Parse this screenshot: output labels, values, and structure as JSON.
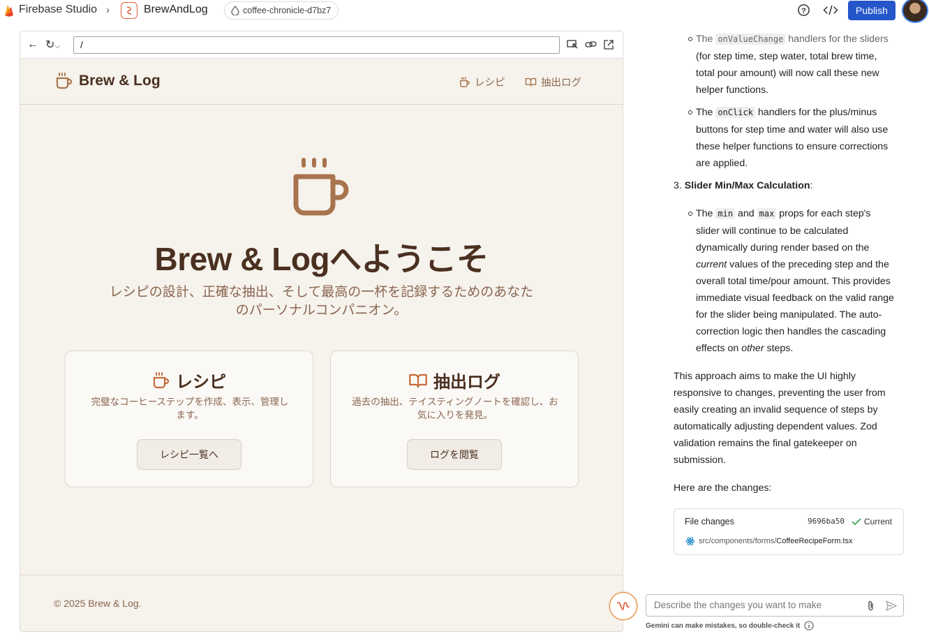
{
  "topbar": {
    "studio_name": "Firebase Studio",
    "app_name": "BrewAndLog",
    "workspace": "coffee-chronicle-d7bz7",
    "publish_label": "Publish"
  },
  "browser": {
    "url": "/"
  },
  "site": {
    "title": "Brew & Log",
    "nav": {
      "recipes": "レシピ",
      "logs": "抽出ログ"
    },
    "hero_title": "Brew & Logへようこそ",
    "hero_sub_line1": "レシピの設計、正確な抽出、そして最高の一杯を記録するためのあなた",
    "hero_sub_line2": "のパーソナルコンパニオン。",
    "cards": [
      {
        "title": "レシピ",
        "desc": "完璧なコーヒーステップを作成、表示、管理します。",
        "button": "レシピ一覧へ"
      },
      {
        "title": "抽出ログ",
        "desc": "過去の抽出、テイスティングノートを確認し、お気に入りを発見。",
        "button": "ログを閲覧"
      }
    ],
    "footer": "© 2025 Brew & Log."
  },
  "chat": {
    "b1_a": "The ",
    "b1_code": "onValueChange",
    "b1_b": " handlers for the sliders",
    "b1_l2": "(for step time, step water, total brew time,",
    "b1_l3": "total pour amount) will now call these new",
    "b1_l4": "helper functions.",
    "b2_a": "The ",
    "b2_code": "onClick",
    "b2_b": " handlers for the plus/minus",
    "b2_l2": "buttons for step time and water will also use",
    "b2_l3": "these helper functions to ensure corrections",
    "b2_l4": "are applied.",
    "item3_num": "3.",
    "item3_bold": "Slider Min/Max Calculation",
    "item3_colon": ":",
    "b3_a": "The ",
    "b3_code1": "min",
    "b3_and": " and ",
    "b3_code2": "max",
    "b3_b": " props for each step's",
    "b3_l2": "slider will continue to be calculated",
    "b3_l3": "dynamically during render based on the",
    "b3_l4_em": "current",
    "b3_l4": " values of the preceding step and the",
    "b3_l5": "overall total time/pour amount. This provides",
    "b3_l6": "immediate visual feedback on the valid range",
    "b3_l7": "for the slider being manipulated. The auto-",
    "b3_l8": "correction logic then handles the cascading",
    "b3_l9_a": "effects on ",
    "b3_l9_em": "other",
    "b3_l9_b": " steps.",
    "para_l1": "This approach aims to make the UI highly",
    "para_l2": "responsive to changes, preventing the user from",
    "para_l3": "easily creating an invalid sequence of steps by",
    "para_l4": "automatically adjusting dependent values. Zod",
    "para_l5": "validation remains the final gatekeeper on",
    "para_l6": "submission.",
    "changes_intro": "Here are the changes:",
    "file_changes": {
      "label": "File changes",
      "hash": "9696ba50",
      "status": "Current",
      "path_dir": "src/components/forms/",
      "path_file": "CoffeeRecipeForm.tsx"
    },
    "input_placeholder": "Describe the changes you want to make",
    "disclaimer": "Gemini can make mistakes, so double-check it"
  }
}
